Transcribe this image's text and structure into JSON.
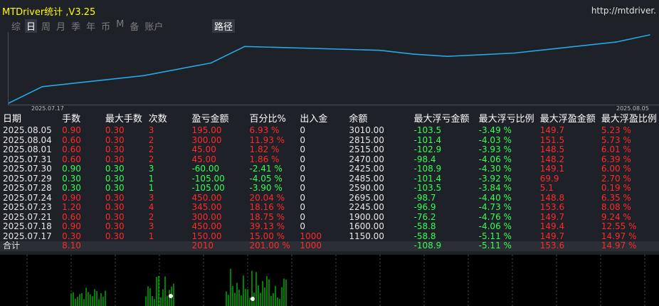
{
  "header": {
    "title": "MTDriver统计 ,V3.25",
    "url": "http://mtdriver."
  },
  "tabs": [
    {
      "label": "综",
      "active": false
    },
    {
      "label": "日",
      "active": true
    },
    {
      "label": "周",
      "active": false
    },
    {
      "label": "月",
      "active": false
    },
    {
      "label": "季",
      "active": false
    },
    {
      "label": "年",
      "active": false
    },
    {
      "label": "币",
      "active": false
    },
    {
      "label": "M",
      "active": false
    },
    {
      "label": "备",
      "active": false
    },
    {
      "label": "账户",
      "active": false
    }
  ],
  "path_button": "路径",
  "chart_data": {
    "type": "line",
    "x": [
      "2025.07.17",
      "2025.07.18",
      "2025.07.21",
      "2025.07.23",
      "2025.07.24",
      "2025.07.28",
      "2025.07.29",
      "2025.07.30",
      "2025.07.31",
      "2025.08.01",
      "2025.08.04",
      "2025.08.05"
    ],
    "y": [
      1150.0,
      1600.0,
      1900.0,
      2245.0,
      2695.0,
      2590.0,
      2485.0,
      2425.0,
      2470.0,
      2515.0,
      2815.0,
      3010.0
    ],
    "x_tick_labels": [
      "2025.07.17",
      "2025.08.05"
    ],
    "ylim": [
      1150,
      3010
    ],
    "line_color": "#27a8e6",
    "grid": false
  },
  "table": {
    "columns": [
      "日期",
      "手数",
      "最大手数",
      "次数",
      "盈亏金额",
      "百分比%",
      "出入金",
      "余额",
      "最大浮亏金额",
      "最大浮亏比例",
      "最大浮盈金额",
      "最大浮盈比例"
    ],
    "rows": [
      [
        "2025.08.05",
        "0.90",
        "0.30",
        "3",
        "195.00",
        "6.93 %",
        "0",
        "3010.00",
        "-103.5",
        "-3.49 %",
        "149.7",
        "5.23 %"
      ],
      [
        "2025.08.04",
        "0.60",
        "0.30",
        "2",
        "300.00",
        "11.93 %",
        "0",
        "2815.00",
        "-101.4",
        "-4.03 %",
        "151.5",
        "5.73 %"
      ],
      [
        "2025.08.01",
        "0.60",
        "0.30",
        "2",
        "45.00",
        "1.82 %",
        "0",
        "2515.00",
        "-102.9",
        "-3.93 %",
        "148.5",
        "6.01 %"
      ],
      [
        "2025.07.31",
        "0.60",
        "0.30",
        "2",
        "45.00",
        "1.86 %",
        "0",
        "2470.00",
        "-98.4",
        "-4.06 %",
        "148.2",
        "6.39 %"
      ],
      [
        "2025.07.30",
        "0.90",
        "0.30",
        "3",
        "-60.00",
        "-2.41 %",
        "0",
        "2425.00",
        "-108.9",
        "-4.30 %",
        "149.1",
        "6.00 %"
      ],
      [
        "2025.07.29",
        "0.30",
        "0.30",
        "1",
        "-105.00",
        "-4.05 %",
        "0",
        "2485.00",
        "-101.4",
        "-3.92 %",
        "69.9",
        "2.70 %"
      ],
      [
        "2025.07.28",
        "0.30",
        "0.30",
        "1",
        "-105.00",
        "-3.90 %",
        "0",
        "2590.00",
        "-103.5",
        "-3.84 %",
        "5.1",
        "0.19 %"
      ],
      [
        "2025.07.24",
        "0.90",
        "0.30",
        "3",
        "450.00",
        "20.04 %",
        "0",
        "2695.00",
        "-98.7",
        "-4.40 %",
        "148.8",
        "6.35 %"
      ],
      [
        "2025.07.23",
        "1.20",
        "0.30",
        "4",
        "345.00",
        "18.16 %",
        "0",
        "2245.00",
        "-96.9",
        "-4.73 %",
        "153.6",
        "8.08 %"
      ],
      [
        "2025.07.21",
        "0.60",
        "0.30",
        "2",
        "300.00",
        "18.75 %",
        "0",
        "1900.00",
        "-76.2",
        "-4.76 %",
        "149.7",
        "9.24 %"
      ],
      [
        "2025.07.18",
        "0.90",
        "0.30",
        "3",
        "450.00",
        "39.13 %",
        "0",
        "1600.00",
        "-58.8",
        "-4.06 %",
        "149.4",
        "12.55 %"
      ],
      [
        "2025.07.17",
        "0.30",
        "0.30",
        "1",
        "150.00",
        "15.00 %",
        "1000",
        "1150.00",
        "-58.8",
        "-5.11 %",
        "149.7",
        "14.97 %"
      ]
    ],
    "total": [
      "合计",
      "8.10",
      "",
      "",
      "2010",
      "201.00 %",
      "1000",
      "",
      "-108.9",
      "-5.11 %",
      "153.6",
      "14.97 %"
    ]
  },
  "colors": {
    "profit": "#ff2a2a",
    "loss": "#33ff55",
    "title": "#ffff00",
    "panel": "#1e2127"
  }
}
